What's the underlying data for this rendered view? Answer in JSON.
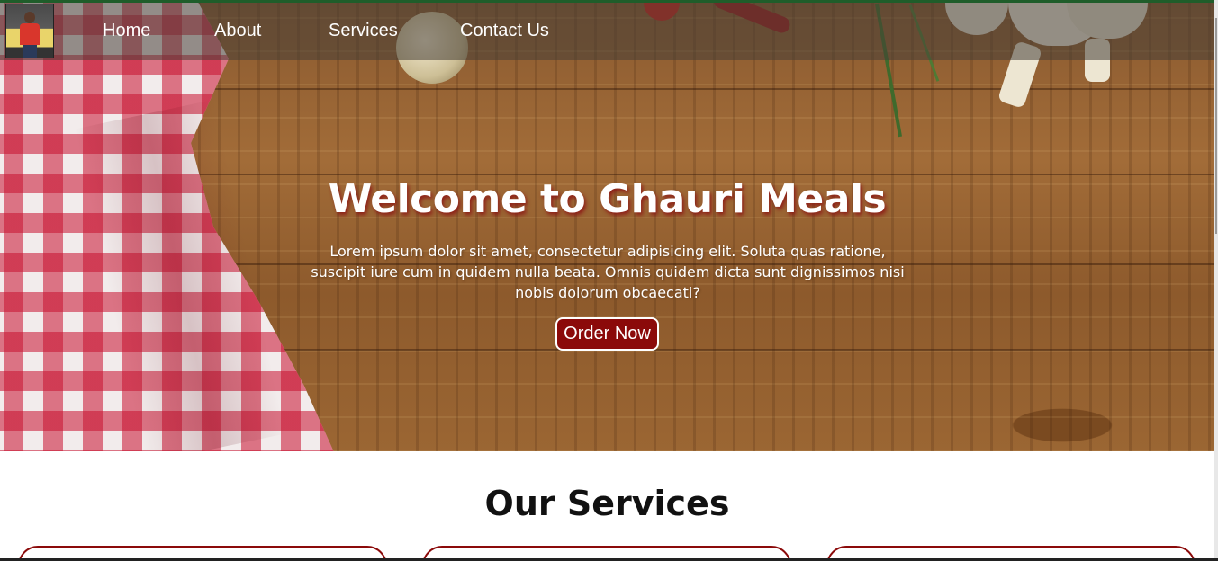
{
  "navbar": {
    "items": [
      {
        "label": "Home"
      },
      {
        "label": "About"
      },
      {
        "label": "Services"
      },
      {
        "label": "Contact Us"
      }
    ]
  },
  "hero": {
    "title": "Welcome to Ghauri Meals",
    "text": "Lorem ipsum dolor sit amet, consectetur adipisicing elit. Soluta quas ratione, suscipit iure cum in quidem nulla beata. Omnis quidem dicta sunt dignissimos nisi nobis dolorum obcaecati?",
    "button_label": "Order Now"
  },
  "services": {
    "title": "Our Services"
  },
  "colors": {
    "accent": "#8b0a0a",
    "top_border": "#1f5d2a"
  }
}
